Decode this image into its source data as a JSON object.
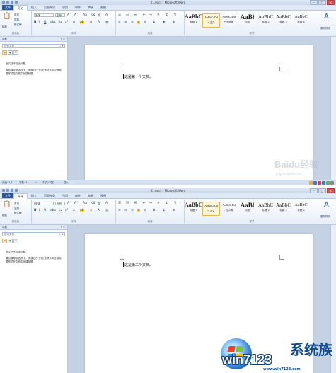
{
  "windows": [
    {
      "title": "01.docx - Microsoft Word",
      "doc_text": "这是第一个文档。",
      "show_watermark": true
    },
    {
      "title": "02.docx - Microsoft Word",
      "doc_text": "这是第二个文档。",
      "show_watermark": false
    }
  ],
  "menu": {
    "file": "文件",
    "tabs": [
      "开始",
      "插入",
      "页面布局",
      "引用",
      "邮件",
      "审阅",
      "视图"
    ]
  },
  "ribbon": {
    "clipboard_label": "剪贴板",
    "paste": "粘贴",
    "cut": "剪切",
    "copy": "复制",
    "format_painter": "格式刷",
    "font_label": "字体",
    "font_name": "宋体",
    "font_size": "五号",
    "paragraph_label": "段落",
    "styles_label": "样式",
    "change_styles": "更改样式",
    "styles": [
      {
        "preview": "AaBbC",
        "name": "标题 1"
      },
      {
        "preview": "AaBbCcDd",
        "name": "↵正文"
      },
      {
        "preview": "AaBbCcDd",
        "name": "↵无间隔"
      },
      {
        "preview": "AaBł",
        "name": "标题"
      },
      {
        "preview": "AaBbC",
        "name": "标题 2"
      },
      {
        "preview": "AaBbC",
        "name": "标题 3"
      },
      {
        "preview": "AaBbC",
        "name": "标题 4"
      },
      {
        "preview": "AaBbC",
        "name": "标题"
      }
    ]
  },
  "navpane": {
    "title": "导航",
    "search_placeholder": "搜索文档",
    "message_line1": "此文档不包含标题。",
    "message_line2": "要创建导航选项卡，请通过在'开始'选项卡中应用标题样式在文档中创建标题。"
  },
  "statusbar": {
    "page": "页面: 1/1",
    "words": "字数: 7",
    "lang": "中文(中国)",
    "mode": "插入"
  },
  "watermark": {
    "baidu": "Baidu经验",
    "url": "jingyan.baidu.com"
  },
  "logo": {
    "brand": "win7123",
    "cn": "系统族",
    "url": "www.win7123.com"
  },
  "colors": {
    "accent": "#2b579a",
    "ribbon": "#dfe9f5",
    "doc_bg": "#c4d2e4"
  }
}
